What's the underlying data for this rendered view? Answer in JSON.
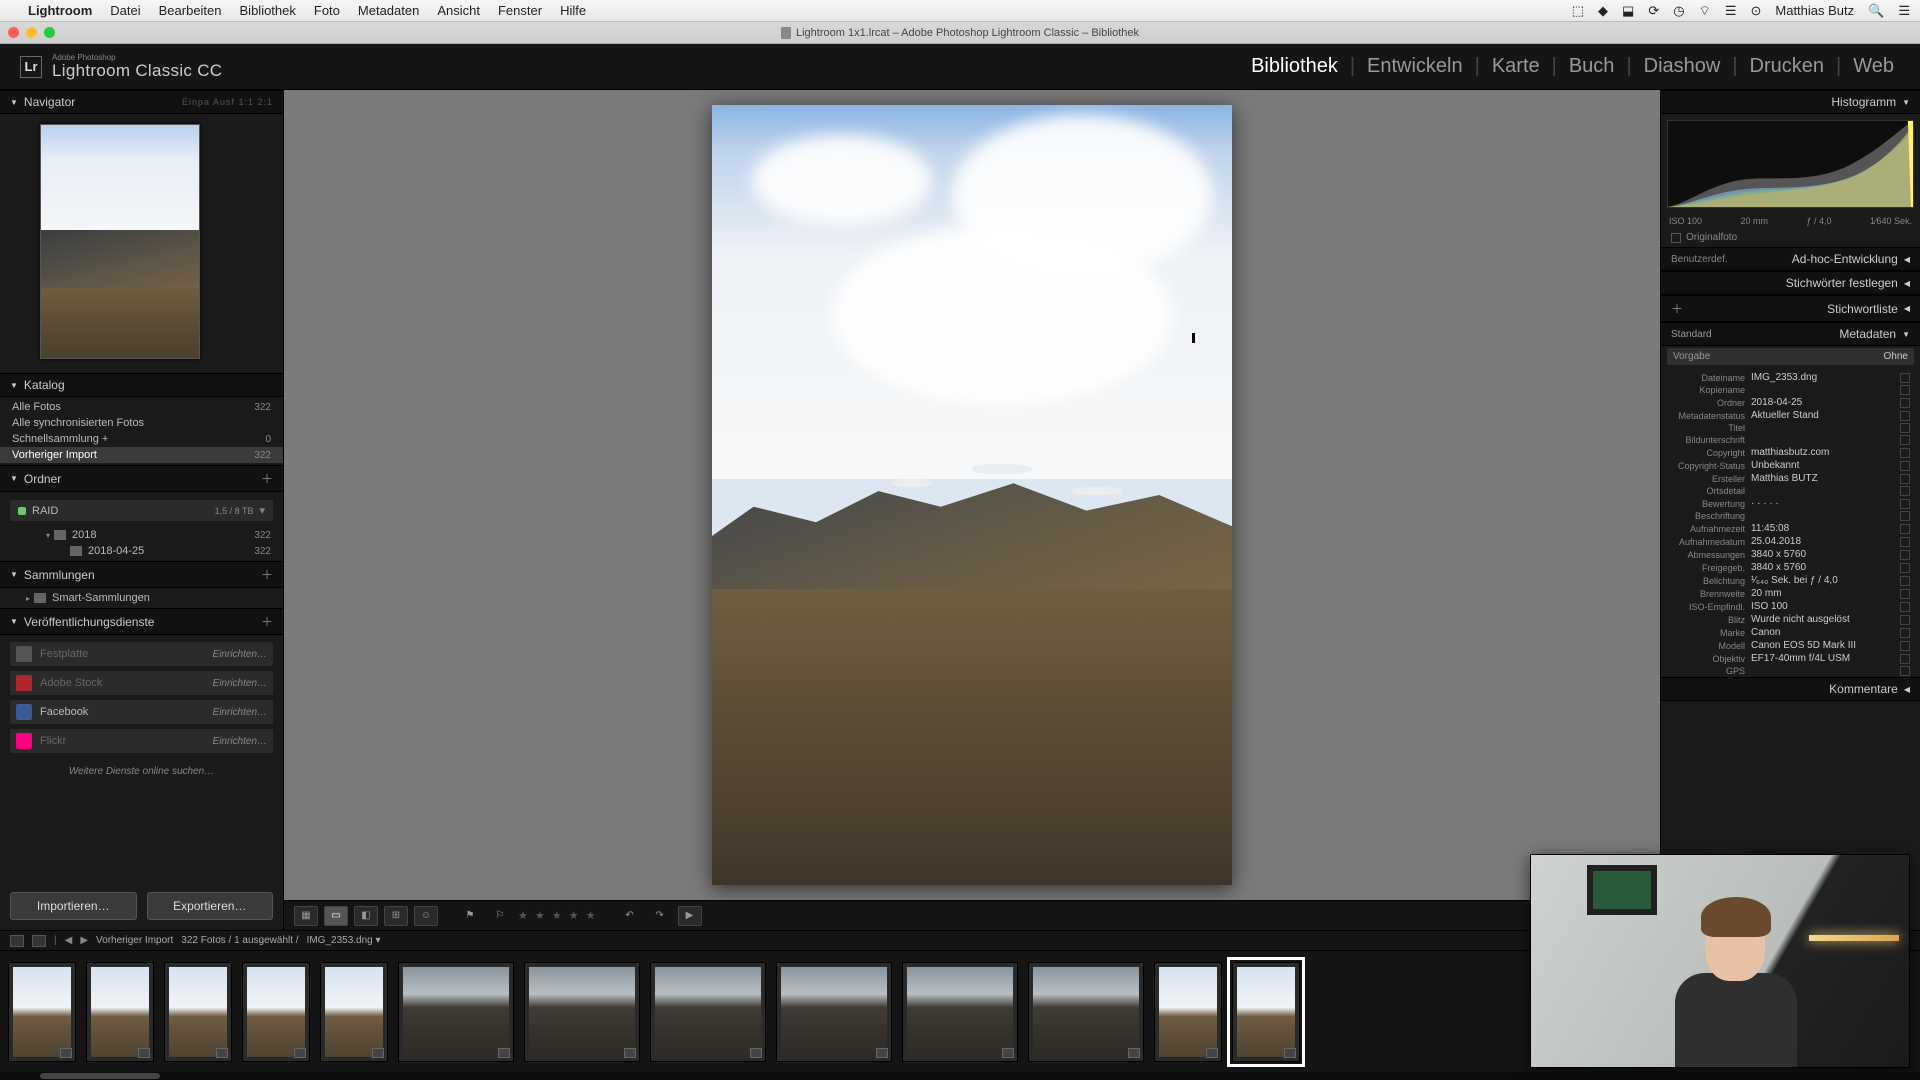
{
  "mac": {
    "app": "Lightroom",
    "menus": [
      "Datei",
      "Bearbeiten",
      "Bibliothek",
      "Foto",
      "Metadaten",
      "Ansicht",
      "Fenster",
      "Hilfe"
    ],
    "user": "Matthias Butz"
  },
  "window_title": "Lightroom 1x1.lrcat – Adobe Photoshop Lightroom Classic – Bibliothek",
  "brand": {
    "sub": "Adobe Photoshop",
    "main": "Lightroom Classic CC"
  },
  "modules": [
    "Bibliothek",
    "Entwickeln",
    "Karte",
    "Buch",
    "Diashow",
    "Drucken",
    "Web"
  ],
  "active_module": "Bibliothek",
  "left": {
    "navigator": {
      "title": "Navigator",
      "extras": "Einpa     Ausf   1:1   2:1"
    },
    "catalog": {
      "title": "Katalog",
      "items": [
        {
          "label": "Alle Fotos",
          "count": "322"
        },
        {
          "label": "Alle synchronisierten Fotos",
          "count": ""
        },
        {
          "label": "Schnellsammlung  +",
          "count": "0"
        },
        {
          "label": "Vorheriger Import",
          "count": "322",
          "selected": true
        }
      ]
    },
    "folders": {
      "title": "Ordner",
      "volume": {
        "name": "RAID",
        "usage": "1,5 / 8 TB"
      },
      "tree": [
        {
          "label": "2018",
          "count": "322",
          "depth": 2
        },
        {
          "label": "2018-04-25",
          "count": "322",
          "depth": 3
        }
      ]
    },
    "collections": {
      "title": "Sammlungen",
      "items": [
        {
          "label": "Smart-Sammlungen"
        }
      ]
    },
    "publish": {
      "title": "Veröffentlichungsdienste",
      "services": [
        {
          "label": "Festplatte",
          "color": "#555",
          "setup": "Einrichten…",
          "dim": true
        },
        {
          "label": "Adobe Stock",
          "color": "#b1272d",
          "setup": "Einrichten…",
          "dim": true
        },
        {
          "label": "Facebook",
          "color": "#3b5998",
          "setup": "Einrichten…"
        },
        {
          "label": "Flickr",
          "color": "#ff0084",
          "setup": "Einrichten…",
          "dim": true
        }
      ],
      "more": "Weitere Dienste online suchen…"
    },
    "import_btn": "Importieren…",
    "export_btn": "Exportieren…"
  },
  "right": {
    "histogram_title": "Histogramm",
    "histo_info": {
      "iso": "ISO 100",
      "focal": "20 mm",
      "aperture": "ƒ / 4,0",
      "shutter": "1⁄640 Sek."
    },
    "original_chk": "Originalfoto",
    "quickdev": {
      "title": "Ad-hoc-Entwicklung",
      "preset_lbl": "Benutzerdef."
    },
    "keywording_title": "Stichwörter festlegen",
    "keywordlist_title": "Stichwortliste",
    "metadata": {
      "title": "Metadaten",
      "preset_lbl": "Standard",
      "preset_row": {
        "lbl": "Vorgabe",
        "val": "Ohne"
      },
      "rows": [
        {
          "lbl": "Dateiname",
          "val": "IMG_2353.dng"
        },
        {
          "lbl": "Kopiename",
          "val": ""
        },
        {
          "lbl": "Ordner",
          "val": "2018-04-25"
        },
        {
          "lbl": "Metadatenstatus",
          "val": "Aktueller Stand"
        },
        {
          "lbl": "Titel",
          "val": ""
        },
        {
          "lbl": "Bildunterschrift",
          "val": ""
        },
        {
          "lbl": "Copyright",
          "val": "matthiasbutz.com"
        },
        {
          "lbl": "Copyright-Status",
          "val": "Unbekannt"
        },
        {
          "lbl": "Ersteller",
          "val": "Matthias BUTZ"
        },
        {
          "lbl": "Ortsdetail",
          "val": ""
        },
        {
          "lbl": "Bewertung",
          "val": "·  ·  ·  ·  ·"
        },
        {
          "lbl": "Beschriftung",
          "val": ""
        },
        {
          "lbl": "Aufnahmezeit",
          "val": "11:45:08"
        },
        {
          "lbl": "Aufnahmedatum",
          "val": "25.04.2018"
        },
        {
          "lbl": "Abmessungen",
          "val": "3840 x 5760"
        },
        {
          "lbl": "Freigegeb.",
          "val": "3840 x 5760"
        },
        {
          "lbl": "Belichtung",
          "val": "¹⁄₆₄₀ Sek. bei ƒ / 4,0"
        },
        {
          "lbl": "Brennweite",
          "val": "20 mm"
        },
        {
          "lbl": "ISO-Empfindl.",
          "val": "ISO 100"
        },
        {
          "lbl": "Blitz",
          "val": "Wurde nicht ausgelöst"
        },
        {
          "lbl": "Marke",
          "val": "Canon"
        },
        {
          "lbl": "Modell",
          "val": "Canon EOS 5D Mark III"
        },
        {
          "lbl": "Objektiv",
          "val": "EF17-40mm f/4L USM"
        },
        {
          "lbl": "GPS",
          "val": ""
        }
      ]
    },
    "comments_title": "Kommentare"
  },
  "filmstrip": {
    "breadcrumb": "Vorheriger Import",
    "count_text": "322 Fotos / 1 ausgewählt /",
    "file": "IMG_2353.dng  ▾",
    "thumbs": [
      {
        "shape": "portrait",
        "variant": "port"
      },
      {
        "shape": "portrait",
        "variant": "port"
      },
      {
        "shape": "portrait",
        "variant": "port"
      },
      {
        "shape": "portrait",
        "variant": "port"
      },
      {
        "shape": "portrait",
        "variant": "port"
      },
      {
        "shape": "landscape",
        "variant": "land"
      },
      {
        "shape": "landscape",
        "variant": "land"
      },
      {
        "shape": "landscape",
        "variant": "land"
      },
      {
        "shape": "landscape",
        "variant": "land"
      },
      {
        "shape": "landscape",
        "variant": "land"
      },
      {
        "shape": "landscape",
        "variant": "land"
      },
      {
        "shape": "portrait",
        "variant": "port"
      },
      {
        "shape": "portrait",
        "variant": "port",
        "selected": true
      }
    ]
  }
}
